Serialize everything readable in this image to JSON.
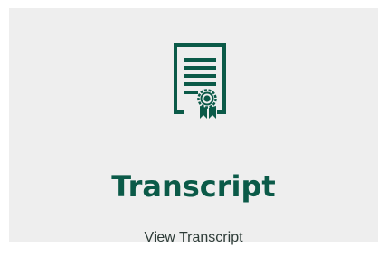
{
  "card": {
    "icon": "certificate-document-icon",
    "title": "Transcript",
    "link_label": "View Transcript"
  },
  "colors": {
    "accent": "#0b5a48",
    "card_background": "#eeeeee",
    "link_text": "#2d3b37"
  }
}
